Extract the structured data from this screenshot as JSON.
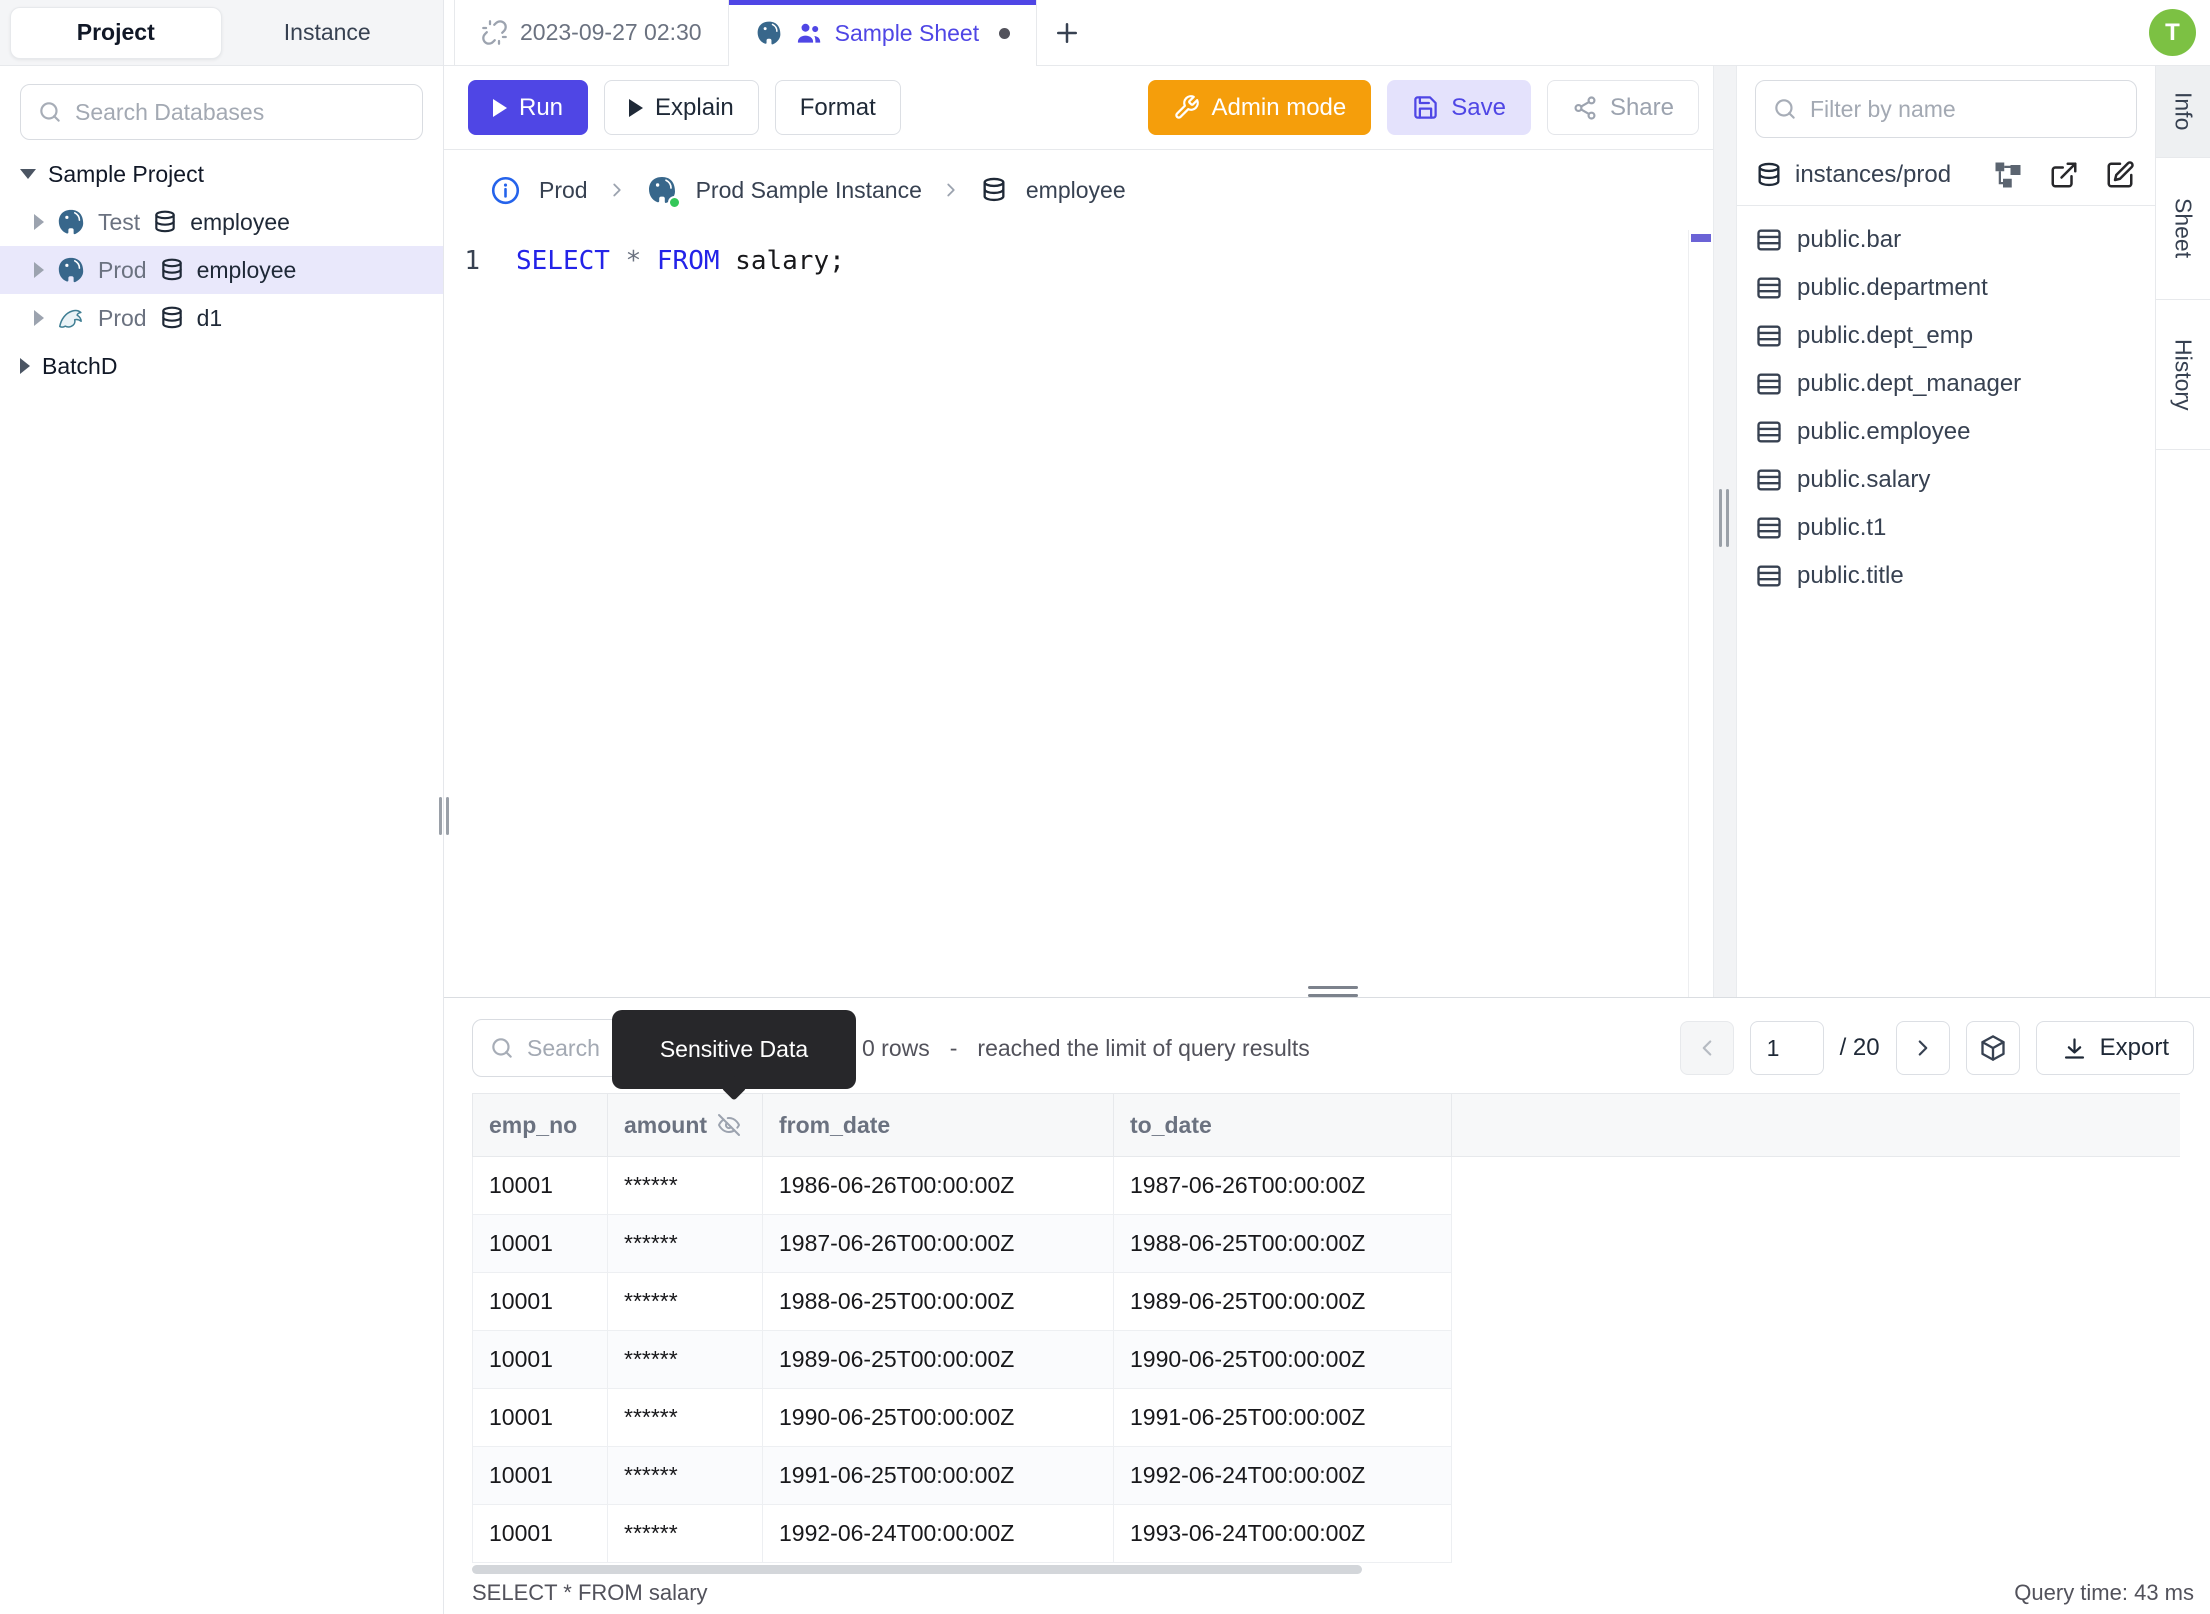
{
  "colors": {
    "accent": "#4f46e5",
    "admin_orange": "#f59e0b",
    "avatar_green": "#7cc143",
    "keyword_blue": "#2323e8",
    "selected_row_bg": "#e9e8fb",
    "tooltip_bg": "#27272a"
  },
  "sidebar": {
    "tabs": {
      "project": "Project",
      "instance": "Instance"
    },
    "search_placeholder": "Search Databases",
    "project_label": "Sample Project",
    "items": [
      {
        "env": "Test",
        "db": "employee",
        "engine": "postgres"
      },
      {
        "env": "Prod",
        "db": "employee",
        "engine": "postgres"
      },
      {
        "env": "Prod",
        "db": "d1",
        "engine": "mysql"
      }
    ],
    "batch_label": "BatchD"
  },
  "tabbar": {
    "time_tab": "2023-09-27 02:30",
    "sheet_tab": "Sample Sheet",
    "new_tab": "+",
    "avatar_initial": "T"
  },
  "toolbar": {
    "run": "Run",
    "explain": "Explain",
    "format": "Format",
    "admin_mode": "Admin mode",
    "save": "Save",
    "share": "Share"
  },
  "breadcrumb": {
    "environment": "Prod",
    "instance": "Prod Sample Instance",
    "database": "employee"
  },
  "editor": {
    "line_number": "1",
    "code": {
      "kw1": "SELECT",
      "star": "*",
      "kw2": "FROM",
      "rest": "salary;"
    }
  },
  "catalog": {
    "filter_placeholder": "Filter by name",
    "header": "instances/prod",
    "tables": [
      "public.bar",
      "public.department",
      "public.dept_emp",
      "public.dept_manager",
      "public.employee",
      "public.salary",
      "public.t1",
      "public.title"
    ]
  },
  "side_tabs": {
    "info": "Info",
    "sheet": "Sheet",
    "history": "History"
  },
  "results": {
    "search_placeholder": "Search",
    "tooltip": "Sensitive Data",
    "rows_count": "0 rows",
    "rows_sep": "-",
    "rows_note": "reached the limit of query results",
    "page_value": "1",
    "page_total": "/ 20",
    "export_label": "Export",
    "columns": {
      "c0": "emp_no",
      "c1": "amount",
      "c2": "from_date",
      "c3": "to_date"
    },
    "rows": [
      [
        "10001",
        "******",
        "1986-06-26T00:00:00Z",
        "1987-06-26T00:00:00Z"
      ],
      [
        "10001",
        "******",
        "1987-06-26T00:00:00Z",
        "1988-06-25T00:00:00Z"
      ],
      [
        "10001",
        "******",
        "1988-06-25T00:00:00Z",
        "1989-06-25T00:00:00Z"
      ],
      [
        "10001",
        "******",
        "1989-06-25T00:00:00Z",
        "1990-06-25T00:00:00Z"
      ],
      [
        "10001",
        "******",
        "1990-06-25T00:00:00Z",
        "1991-06-25T00:00:00Z"
      ],
      [
        "10001",
        "******",
        "1991-06-25T00:00:00Z",
        "1992-06-24T00:00:00Z"
      ],
      [
        "10001",
        "******",
        "1992-06-24T00:00:00Z",
        "1993-06-24T00:00:00Z"
      ]
    ],
    "status_query": "SELECT * FROM salary",
    "status_time": "Query time: 43 ms"
  }
}
